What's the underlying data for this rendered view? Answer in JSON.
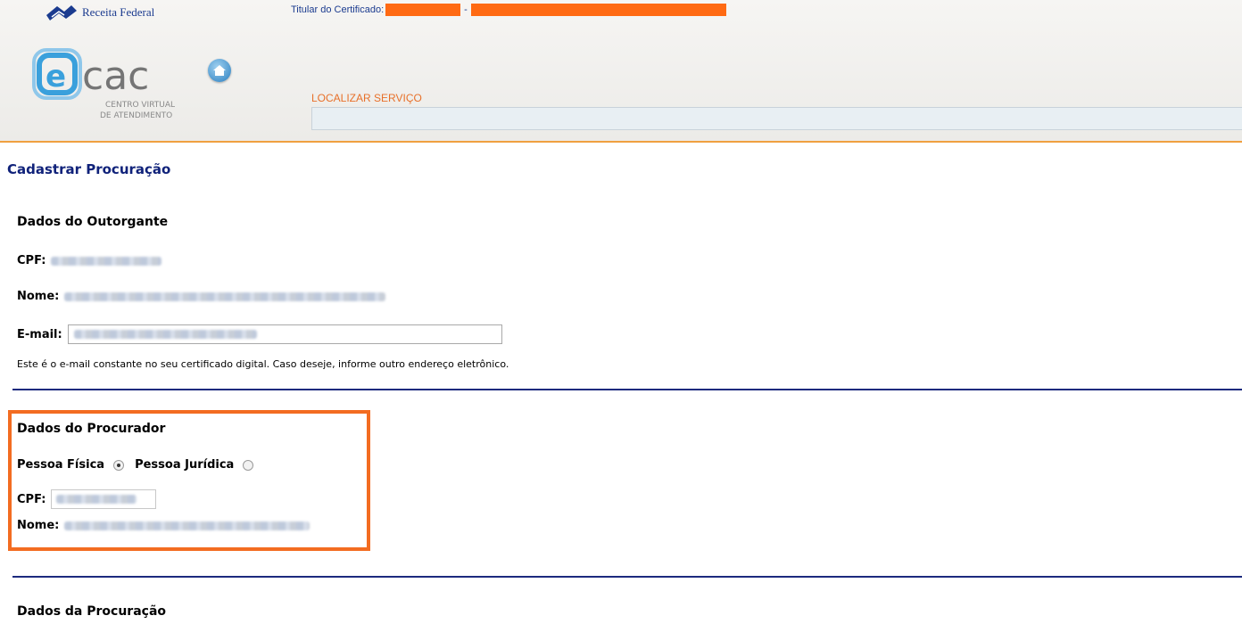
{
  "header": {
    "agency": "Receita Federal",
    "certificate_label": "Titular do Certificado:",
    "certificate_separator": "-",
    "logo_main": "cac",
    "logo_sub1": "CENTRO VIRTUAL",
    "logo_sub2": "DE ATENDIMENTO",
    "search_label": "LOCALIZAR SERVIÇO",
    "search_value": "",
    "colors": {
      "brand_blue": "#1b3b8f",
      "accent_orange": "#f36c21",
      "logo_blue": "#3aa0dc"
    },
    "icons": {
      "agency": "receita-federal-logo-icon",
      "home": "home-icon"
    }
  },
  "page": {
    "title": "Cadastrar Procuração"
  },
  "outorgante": {
    "section_title": "Dados do Outorgante",
    "cpf_label": "CPF:",
    "nome_label": "Nome:",
    "email_label": "E-mail:",
    "email_note": "Este é o e-mail constante no seu certificado digital. Caso deseje, informe outro endereço eletrônico."
  },
  "procurador": {
    "section_title": "Dados do Procurador",
    "pf_label": "Pessoa Física",
    "pj_label": "Pessoa Jurídica",
    "selected": "Pessoa Física",
    "cpf_label": "CPF:",
    "nome_label": "Nome:"
  },
  "procuracao": {
    "section_title": "Dados da Procuração"
  }
}
